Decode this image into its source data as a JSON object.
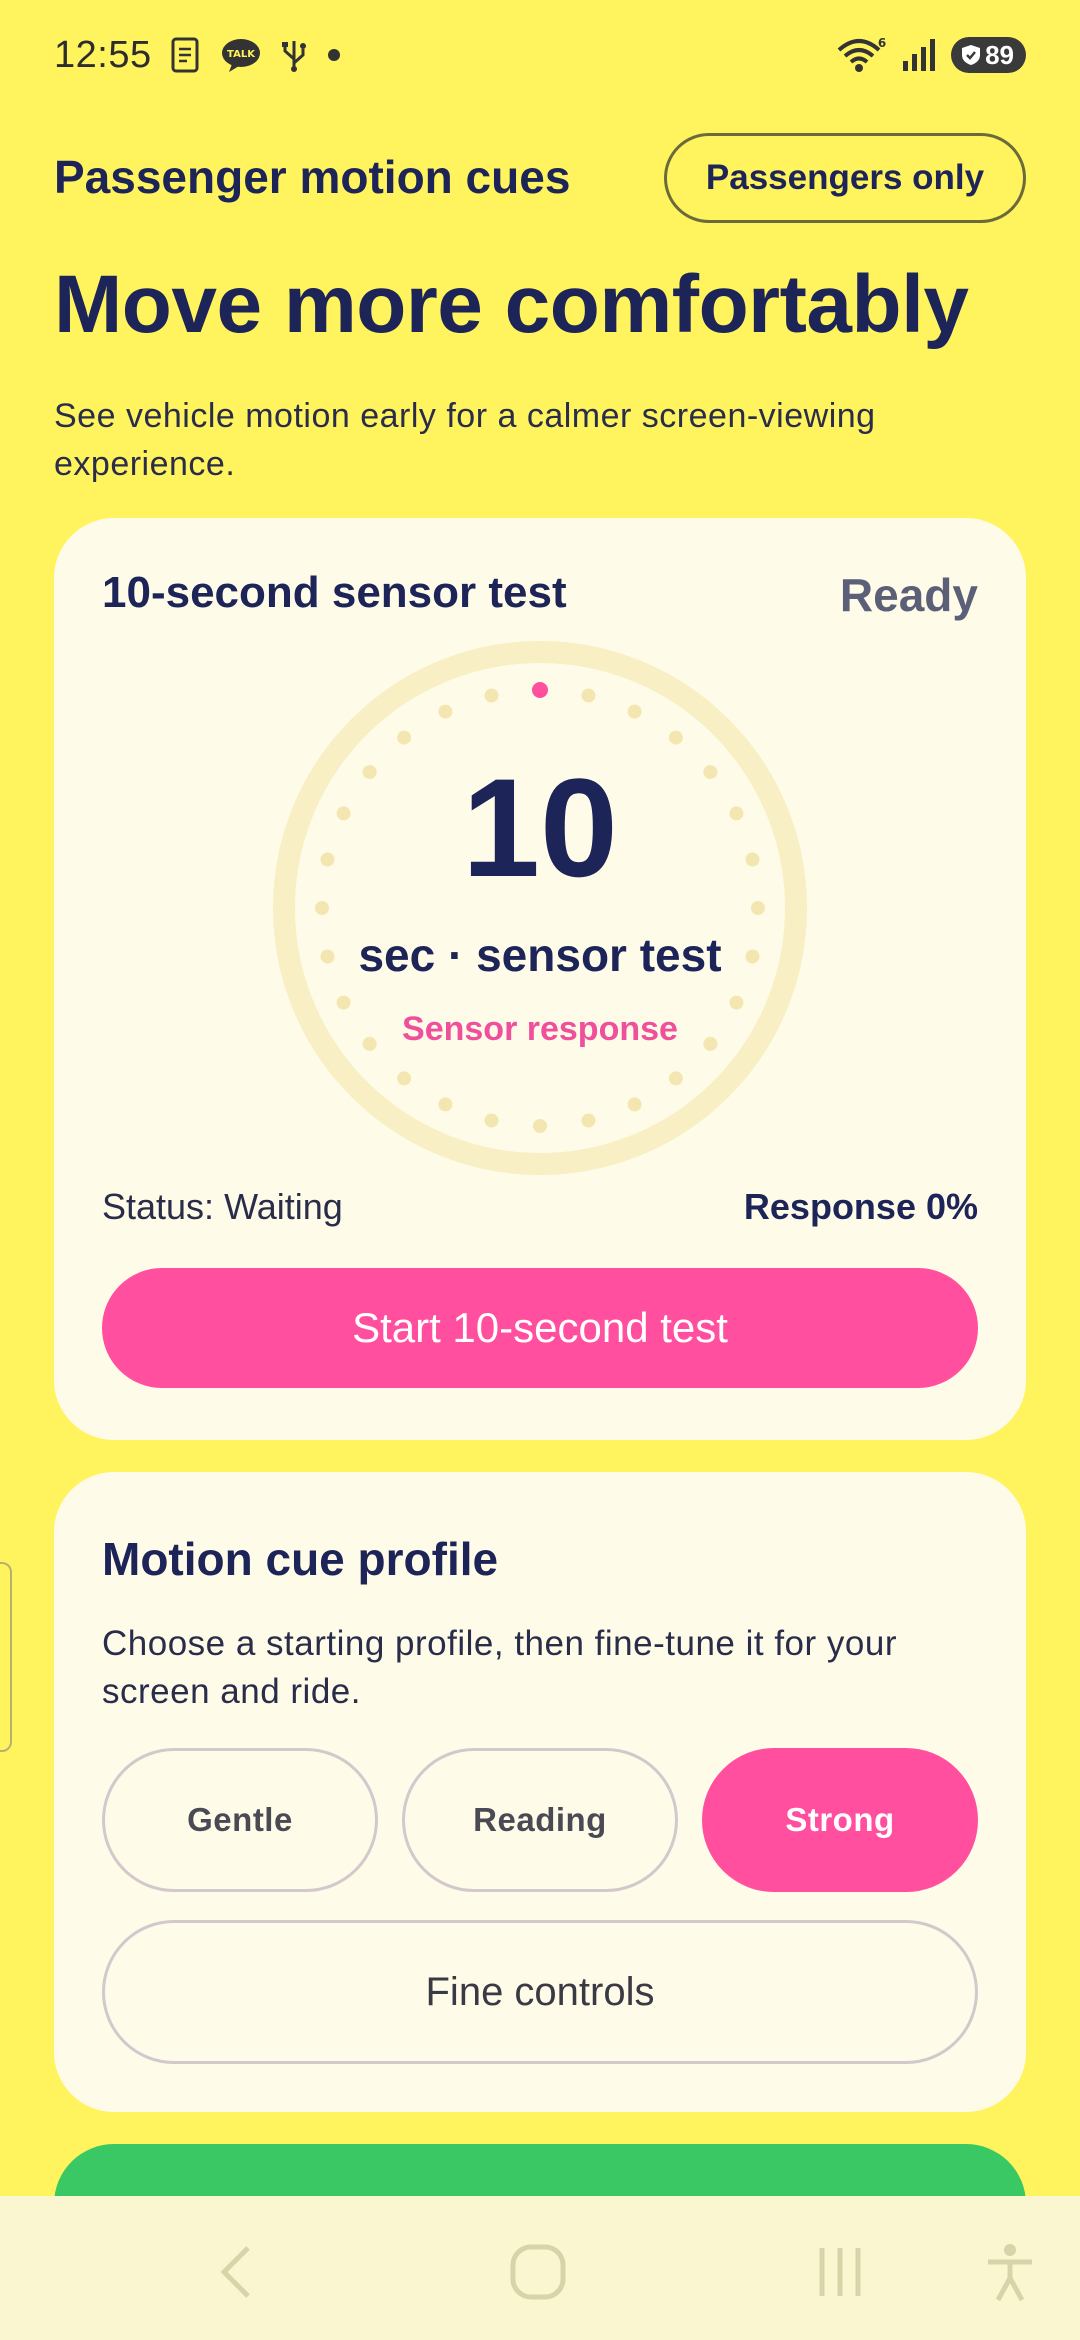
{
  "status_bar": {
    "time": "12:55",
    "icons": [
      "document-icon",
      "talk-icon",
      "usb-icon",
      "dot-icon"
    ],
    "talk_label": "TALK",
    "right_icons": [
      "wifi-icon",
      "signal-icon"
    ],
    "wifi_badge": "6",
    "battery": "89"
  },
  "header": {
    "app_title": "Passenger motion cues",
    "badge": "Passengers only",
    "headline": "Move more comfortably",
    "subline": "See vehicle motion early for a calmer screen-viewing experience."
  },
  "sensor_test": {
    "title": "10-second sensor test",
    "state": "Ready",
    "countdown": "10",
    "unit_label": "sec · sensor test",
    "sub_label": "Sensor response",
    "status": "Status: Waiting",
    "response": "Response 0%",
    "start_button": "Start 10-second test",
    "progress": 0
  },
  "profile": {
    "title": "Motion cue profile",
    "description": "Choose a starting profile, then fine-tune it for your screen and ride.",
    "options": [
      "Gentle",
      "Reading",
      "Strong"
    ],
    "selected": "Strong",
    "fine_controls": "Fine controls"
  },
  "colors": {
    "background": "#fff35e",
    "card": "#fffbe9",
    "accent_pink": "#ff4f9e",
    "navy": "#1d2458",
    "green": "#3ac865",
    "dial_dot": "#f3e6b0"
  },
  "nav": {
    "icons": [
      "back-icon",
      "home-icon",
      "recents-icon",
      "accessibility-icon"
    ]
  }
}
